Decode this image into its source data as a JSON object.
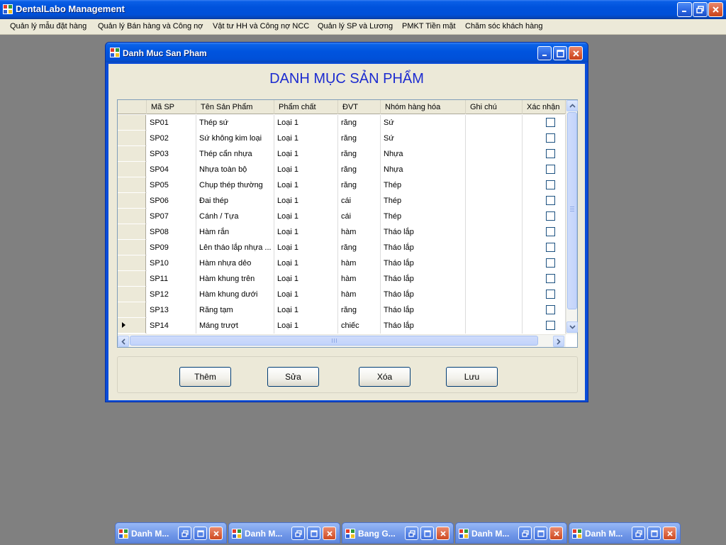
{
  "app": {
    "title": "DentalLabo Management"
  },
  "menu": {
    "items": [
      "Quản lý mẫu đặt hàng",
      "Quản lý Bán hàng và Công nợ",
      "Vật tư HH và Công nợ NCC",
      "Quản lý SP và Lương",
      "PMKT Tiền mặt",
      "Chăm sóc khách hàng"
    ]
  },
  "child_window": {
    "title": "Danh Muc San Pham",
    "heading": "DANH MỤC SẢN PHẨM"
  },
  "grid": {
    "columns": [
      "Mã SP",
      "Tên Sản Phẩm",
      "Phẩm chất",
      "ĐVT",
      "Nhóm hàng hóa",
      "Ghi chú",
      "Xác nhận"
    ],
    "rows": [
      {
        "ma": "SP01",
        "ten": "Thép sứ",
        "pham_chat": "Loại 1",
        "dvt": "răng",
        "nhom": "Sứ",
        "ghi_chu": "",
        "xac_nhan": false
      },
      {
        "ma": "SP02",
        "ten": "Sứ không kim loại",
        "pham_chat": "Loại 1",
        "dvt": "răng",
        "nhom": "Sứ",
        "ghi_chu": "",
        "xac_nhan": false
      },
      {
        "ma": "SP03",
        "ten": "Thép cẩn nhựa",
        "pham_chat": "Loại 1",
        "dvt": "răng",
        "nhom": "Nhựa",
        "ghi_chu": "",
        "xac_nhan": false
      },
      {
        "ma": "SP04",
        "ten": "Nhựa toàn bộ",
        "pham_chat": "Loại 1",
        "dvt": "răng",
        "nhom": "Nhựa",
        "ghi_chu": "",
        "xac_nhan": false
      },
      {
        "ma": "SP05",
        "ten": "Chụp thép thường",
        "pham_chat": "Loại 1",
        "dvt": "răng",
        "nhom": "Thép",
        "ghi_chu": "",
        "xac_nhan": false
      },
      {
        "ma": "SP06",
        "ten": "Đai thép",
        "pham_chat": "Loại 1",
        "dvt": "cái",
        "nhom": "Thép",
        "ghi_chu": "",
        "xac_nhan": false
      },
      {
        "ma": "SP07",
        "ten": "Cánh / Tựa",
        "pham_chat": "Loại 1",
        "dvt": "cái",
        "nhom": "Thép",
        "ghi_chu": "",
        "xac_nhan": false
      },
      {
        "ma": "SP08",
        "ten": "Hàm rắn",
        "pham_chat": "Loại 1",
        "dvt": "hàm",
        "nhom": "Tháo lắp",
        "ghi_chu": "",
        "xac_nhan": false
      },
      {
        "ma": "SP09",
        "ten": "Lên tháo lắp nhựa ...",
        "pham_chat": "Loại 1",
        "dvt": "răng",
        "nhom": "Tháo lắp",
        "ghi_chu": "",
        "xac_nhan": false
      },
      {
        "ma": "SP10",
        "ten": "Hàm nhựa dẻo",
        "pham_chat": "Loại 1",
        "dvt": "hàm",
        "nhom": "Tháo lắp",
        "ghi_chu": "",
        "xac_nhan": false
      },
      {
        "ma": "SP11",
        "ten": "Hàm khung trên",
        "pham_chat": "Loại 1",
        "dvt": "hàm",
        "nhom": "Tháo lắp",
        "ghi_chu": "",
        "xac_nhan": false
      },
      {
        "ma": "SP12",
        "ten": "Hàm khung dưới",
        "pham_chat": "Loại 1",
        "dvt": "hàm",
        "nhom": "Tháo lắp",
        "ghi_chu": "",
        "xac_nhan": false
      },
      {
        "ma": "SP13",
        "ten": "Răng tạm",
        "pham_chat": "Loại 1",
        "dvt": "răng",
        "nhom": "Tháo lắp",
        "ghi_chu": "",
        "xac_nhan": false
      },
      {
        "ma": "SP14",
        "ten": "Máng trượt",
        "pham_chat": "Loại 1",
        "dvt": "chiếc",
        "nhom": "Tháo lắp",
        "ghi_chu": "",
        "xac_nhan": false
      }
    ],
    "current_row": 13
  },
  "buttons": {
    "add": "Thêm",
    "edit": "Sửa",
    "delete": "Xóa",
    "save": "Lưu"
  },
  "minimized_windows": [
    {
      "title": "Danh M..."
    },
    {
      "title": "Danh M..."
    },
    {
      "title": "Bang G..."
    },
    {
      "title": "Danh M..."
    },
    {
      "title": "Danh M..."
    }
  ],
  "colors": {
    "title_bar": "#0054e3",
    "heading": "#1c2bd0",
    "mdi_background": "#808080",
    "form_background": "#ece9d8"
  }
}
